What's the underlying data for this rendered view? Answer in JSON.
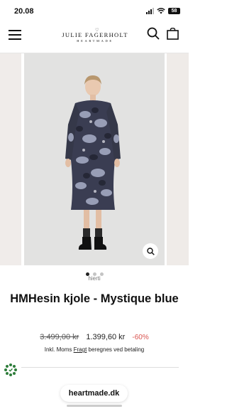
{
  "status_bar": {
    "time": "20.08",
    "battery": "58"
  },
  "header": {
    "logo_main": "JULIE FAGERHOLT",
    "logo_sub": "HEARTMADE"
  },
  "gallery": {
    "image_count": 3,
    "active_index": 0,
    "brand_fragment": "hjerti"
  },
  "product": {
    "title": "HMHesin kjole - Mystique blue",
    "old_price": "3.499,00 kr",
    "new_price": "1.399,60 kr",
    "discount": "-60%",
    "tax_prefix": "Inkl. Moms",
    "tax_link": "Fragt",
    "tax_suffix": "beregnes ved betaling"
  },
  "browser": {
    "url": "heartmade.dk"
  },
  "colors": {
    "discount": "#d9534f",
    "gallery_bg": "#e2e2e1"
  }
}
